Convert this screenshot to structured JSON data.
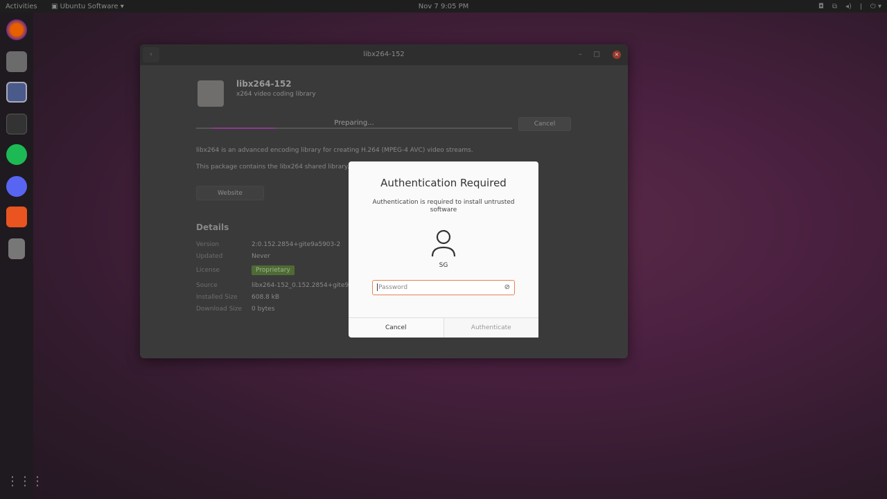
{
  "topbar": {
    "activities": "Activities",
    "app_menu": "Ubuntu Software",
    "clock": "Nov 7  9:05 PM"
  },
  "dock": {
    "items": [
      "firefox",
      "files",
      "screenshot",
      "terminal",
      "spotify",
      "discord",
      "ubuntu-software",
      "package"
    ]
  },
  "window": {
    "title": "libx264-152",
    "app_name": "libx264-152",
    "app_summary": "x264 video coding library",
    "progress_label": "Preparing...",
    "progress_fraction": 0.2,
    "cancel": "Cancel",
    "description": [
      "libx264 is an advanced encoding library for creating H.264 (MPEG-4 AVC) video streams.",
      "This package contains the libx264 shared library."
    ],
    "website": "Website",
    "details_heading": "Details",
    "details": [
      {
        "k": "Version",
        "v": "2:0.152.2854+gite9a5903-2"
      },
      {
        "k": "Updated",
        "v": "Never"
      },
      {
        "k": "License",
        "v": "Proprietary"
      },
      {
        "k": "Source",
        "v": "libx264-152_0.152.2854+gite9a5"
      },
      {
        "k": "Installed Size",
        "v": "608.8 kB"
      },
      {
        "k": "Download Size",
        "v": "0 bytes"
      }
    ]
  },
  "dialog": {
    "title": "Authentication Required",
    "message": "Authentication is required to install untrusted software",
    "user": "SG",
    "password_placeholder": "Password",
    "cancel": "Cancel",
    "authenticate": "Authenticate"
  },
  "colors": {
    "accent": "#e9814f",
    "progress": "#8b3a8b",
    "license": "#4f6b35"
  }
}
